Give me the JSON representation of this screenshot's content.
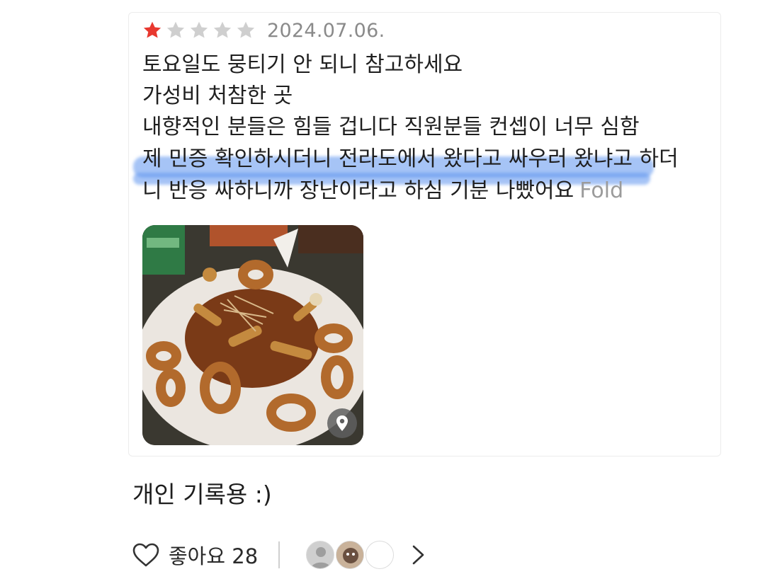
{
  "review": {
    "rating": 1,
    "rating_max": 5,
    "date": "2024.07.06.",
    "lines": [
      "토요일도 뭉티기 안 되니 참고하세요",
      "가성비 처참한 곳",
      "내향적인 분들은 힘들 겁니다 직원분들 컨셉이 너무 심함",
      "제 민증 확인하시더니 전라도에서 왔다고 싸우러 왔냐고 하더",
      "니 반응 싸하니까 장난이라고 하심 기분 나빴어요"
    ],
    "fold_label": "Fold",
    "photo_icon": "location-pin-icon"
  },
  "caption": "개인 기록용 :)",
  "footer": {
    "like_label": "좋아요 28",
    "icons": [
      "heart-icon",
      "avatar",
      "chevron-right-icon"
    ]
  },
  "colors": {
    "star_filled": "#e8382f",
    "star_empty": "#cfcfcf",
    "highlight": "#5c94ee"
  }
}
